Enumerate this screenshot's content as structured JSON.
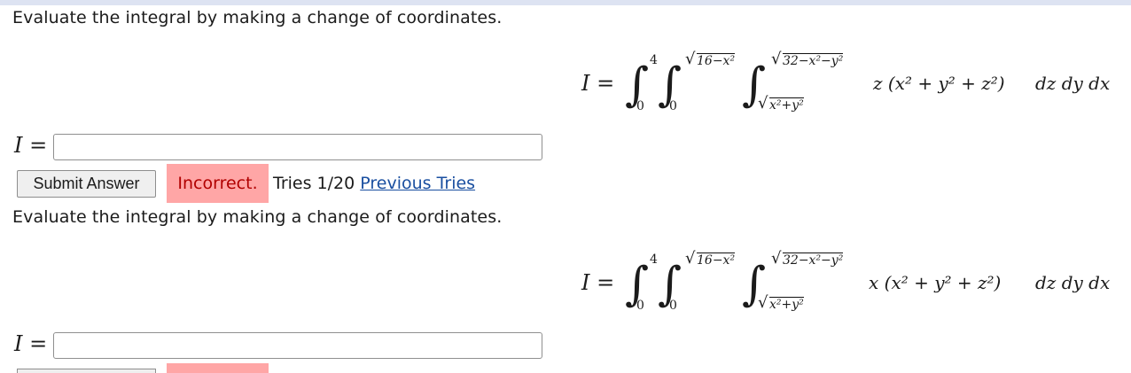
{
  "problems": [
    {
      "prompt": "Evaluate the integral by making a change of coordinates.",
      "formula": {
        "lhs": "I =",
        "outer_lower": "0",
        "outer_upper": "4",
        "middle_lower": "0",
        "middle_upper": "16−x²",
        "inner_lower": "x²+y²",
        "inner_upper": "32−x²−y²",
        "integrand": "z (x² + y² + z²)",
        "differentials": "dz dy dx"
      },
      "answer_label": "I =",
      "answer_value": "",
      "submit_label": "Submit Answer",
      "status_text": "Incorrect.",
      "tries_text": "Tries 1/20",
      "previous_tries_label": "Previous Tries"
    },
    {
      "prompt": "Evaluate the integral by making a change of coordinates.",
      "formula": {
        "lhs": "I =",
        "outer_lower": "0",
        "outer_upper": "4",
        "middle_lower": "0",
        "middle_upper": "16−x²",
        "inner_lower": "x²+y²",
        "inner_upper": "32−x²−y²",
        "integrand": "x (x² + y² + z²)",
        "differentials": "dz dy dx"
      },
      "answer_label": "I =",
      "answer_value": ""
    }
  ],
  "colors": {
    "incorrect_bg": "#ffa6a6",
    "incorrect_text": "#b10000",
    "link": "#1a4fa0"
  }
}
